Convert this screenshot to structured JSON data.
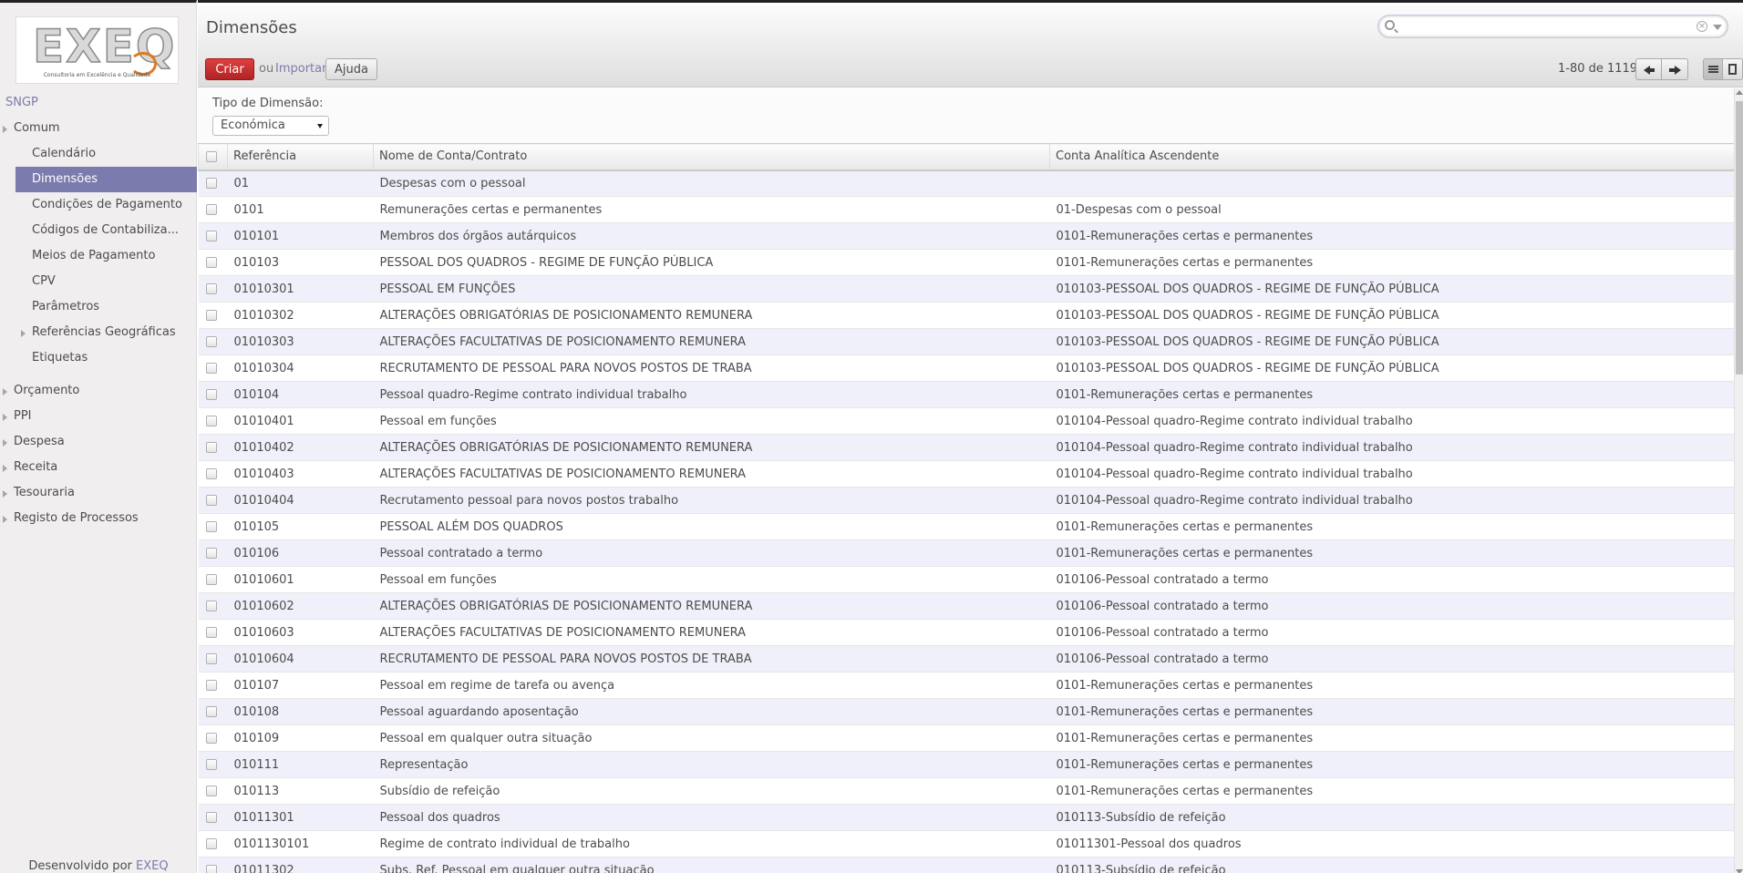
{
  "logo": {
    "text": "EXEQ",
    "tagline": "Consultoria em Excelência e Qualidade"
  },
  "sidebar": {
    "section": "SNGP",
    "items": [
      {
        "label": "Comum",
        "level": 0,
        "expandable": true
      },
      {
        "label": "Calendário",
        "level": 1
      },
      {
        "label": "Dimensões",
        "level": 1,
        "active": true
      },
      {
        "label": "Condições de Pagamento",
        "level": 1
      },
      {
        "label": "Códigos de Contabiliza...",
        "level": 1
      },
      {
        "label": "Meios de Pagamento",
        "level": 1
      },
      {
        "label": "CPV",
        "level": 1
      },
      {
        "label": "Parâmetros",
        "level": 1
      },
      {
        "label": "Referências Geográficas",
        "level": 1,
        "expandable": true
      },
      {
        "label": "Etiquetas",
        "level": 1
      },
      {
        "label": "Orçamento",
        "level": 0,
        "expandable": true,
        "gap": true
      },
      {
        "label": "PPI",
        "level": 0,
        "expandable": true
      },
      {
        "label": "Despesa",
        "level": 0,
        "expandable": true
      },
      {
        "label": "Receita",
        "level": 0,
        "expandable": true
      },
      {
        "label": "Tesouraria",
        "level": 0,
        "expandable": true
      },
      {
        "label": "Registo de Processos",
        "level": 0,
        "expandable": true
      }
    ],
    "footer_text": "Desenvolvido por",
    "footer_brand": "EXEQ"
  },
  "header": {
    "title": "Dimensões",
    "search_value": "",
    "create_label": "Criar",
    "or_label": "ou",
    "import_label": "Importar",
    "help_label": "Ajuda",
    "pager": "1-80 de 1119"
  },
  "filter": {
    "label": "Tipo de Dimensão:",
    "value": "Económica"
  },
  "table": {
    "columns": [
      "Referência",
      "Nome de Conta/Contrato",
      "Conta Analítica Ascendente"
    ],
    "rows": [
      [
        "01",
        "Despesas com o pessoal",
        ""
      ],
      [
        "0101",
        "Remunerações certas e permanentes",
        "01-Despesas com o pessoal"
      ],
      [
        "010101",
        "Membros dos órgãos autárquicos",
        "0101-Remunerações certas e permanentes"
      ],
      [
        "010103",
        "PESSOAL DOS QUADROS - REGIME DE FUNÇÃO PÚBLICA",
        "0101-Remunerações certas e permanentes"
      ],
      [
        "01010301",
        "PESSOAL EM FUNÇÕES",
        "010103-PESSOAL DOS QUADROS - REGIME DE FUNÇÃO PÚBLICA"
      ],
      [
        "01010302",
        "ALTERAÇÕES OBRIGATÓRIAS DE POSICIONAMENTO REMUNERA",
        "010103-PESSOAL DOS QUADROS - REGIME DE FUNÇÃO PÚBLICA"
      ],
      [
        "01010303",
        "ALTERAÇÕES FACULTATIVAS DE POSICIONAMENTO REMUNERA",
        "010103-PESSOAL DOS QUADROS - REGIME DE FUNÇÃO PÚBLICA"
      ],
      [
        "01010304",
        "RECRUTAMENTO DE PESSOAL PARA NOVOS POSTOS DE TRABA",
        "010103-PESSOAL DOS QUADROS - REGIME DE FUNÇÃO PÚBLICA"
      ],
      [
        "010104",
        "Pessoal quadro-Regime contrato individual trabalho",
        "0101-Remunerações certas e permanentes"
      ],
      [
        "01010401",
        "Pessoal em funções",
        "010104-Pessoal quadro-Regime contrato individual trabalho"
      ],
      [
        "01010402",
        "ALTERAÇÕES OBRIGATÓRIAS DE POSICIONAMENTO REMUNERA",
        "010104-Pessoal quadro-Regime contrato individual trabalho"
      ],
      [
        "01010403",
        "ALTERAÇÕES FACULTATIVAS DE POSICIONAMENTO REMUNERA",
        "010104-Pessoal quadro-Regime contrato individual trabalho"
      ],
      [
        "01010404",
        "Recrutamento pessoal para novos postos trabalho",
        "010104-Pessoal quadro-Regime contrato individual trabalho"
      ],
      [
        "010105",
        "PESSOAL ALÉM DOS QUADROS",
        "0101-Remunerações certas e permanentes"
      ],
      [
        "010106",
        "Pessoal contratado a termo",
        "0101-Remunerações certas e permanentes"
      ],
      [
        "01010601",
        "Pessoal em funções",
        "010106-Pessoal contratado a termo"
      ],
      [
        "01010602",
        "ALTERAÇÕES OBRIGATÓRIAS DE POSICIONAMENTO REMUNERA",
        "010106-Pessoal contratado a termo"
      ],
      [
        "01010603",
        "ALTERAÇÕES FACULTATIVAS DE POSICIONAMENTO REMUNERA",
        "010106-Pessoal contratado a termo"
      ],
      [
        "01010604",
        "RECRUTAMENTO DE PESSOAL PARA NOVOS POSTOS DE TRABA",
        "010106-Pessoal contratado a termo"
      ],
      [
        "010107",
        "Pessoal em regime de tarefa ou avença",
        "0101-Remunerações certas e permanentes"
      ],
      [
        "010108",
        "Pessoal aguardando aposentação",
        "0101-Remunerações certas e permanentes"
      ],
      [
        "010109",
        "Pessoal em qualquer outra situação",
        "0101-Remunerações certas e permanentes"
      ],
      [
        "010111",
        "Representação",
        "0101-Remunerações certas e permanentes"
      ],
      [
        "010113",
        "Subsídio de refeição",
        "0101-Remunerações certas e permanentes"
      ],
      [
        "01011301",
        "Pessoal dos quadros",
        "010113-Subsídio de refeição"
      ],
      [
        "0101130101",
        "Regime de contrato individual de trabalho",
        "01011301-Pessoal dos quadros"
      ],
      [
        "01011302",
        "Subs. Ref. Pessoal em qualquer outra situação",
        "010113-Subsídio de refeição"
      ]
    ]
  },
  "colors": {
    "accent": "#7c7bad",
    "create": "#c52c2c",
    "row_alt": "#f0f0fa"
  }
}
